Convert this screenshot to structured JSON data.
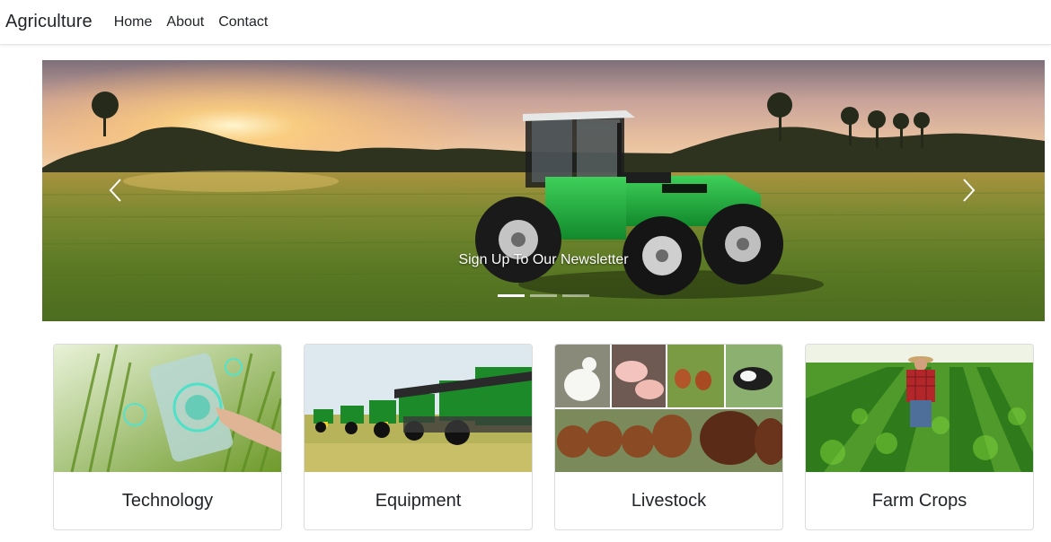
{
  "navbar": {
    "brand": "Agriculture",
    "links": [
      "Home",
      "About",
      "Contact"
    ]
  },
  "carousel": {
    "caption": "Sign Up To Our Newsletter",
    "prev_icon": "chevron-left-icon",
    "next_icon": "chevron-right-icon",
    "slide_count": 3,
    "active_slide": 1
  },
  "cards": [
    {
      "title": "Technology",
      "image": "smart-farming-tablet-image"
    },
    {
      "title": "Equipment",
      "image": "tractors-row-image"
    },
    {
      "title": "Livestock",
      "image": "farm-animals-collage-image"
    },
    {
      "title": "Farm Crops",
      "image": "farmer-in-field-image"
    }
  ]
}
